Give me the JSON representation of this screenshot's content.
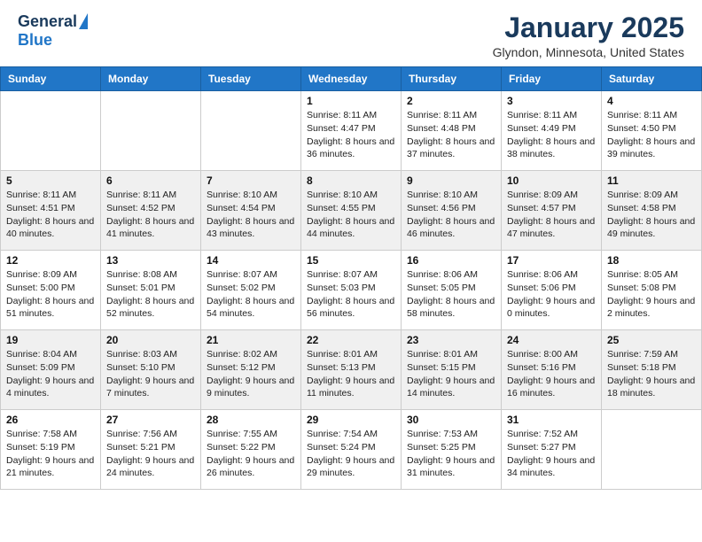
{
  "logo": {
    "general": "General",
    "blue": "Blue"
  },
  "title": "January 2025",
  "location": "Glyndon, Minnesota, United States",
  "days_header": [
    "Sunday",
    "Monday",
    "Tuesday",
    "Wednesday",
    "Thursday",
    "Friday",
    "Saturday"
  ],
  "weeks": [
    [
      {
        "day": "",
        "info": ""
      },
      {
        "day": "",
        "info": ""
      },
      {
        "day": "",
        "info": ""
      },
      {
        "day": "1",
        "info": "Sunrise: 8:11 AM\nSunset: 4:47 PM\nDaylight: 8 hours and 36 minutes."
      },
      {
        "day": "2",
        "info": "Sunrise: 8:11 AM\nSunset: 4:48 PM\nDaylight: 8 hours and 37 minutes."
      },
      {
        "day": "3",
        "info": "Sunrise: 8:11 AM\nSunset: 4:49 PM\nDaylight: 8 hours and 38 minutes."
      },
      {
        "day": "4",
        "info": "Sunrise: 8:11 AM\nSunset: 4:50 PM\nDaylight: 8 hours and 39 minutes."
      }
    ],
    [
      {
        "day": "5",
        "info": "Sunrise: 8:11 AM\nSunset: 4:51 PM\nDaylight: 8 hours and 40 minutes."
      },
      {
        "day": "6",
        "info": "Sunrise: 8:11 AM\nSunset: 4:52 PM\nDaylight: 8 hours and 41 minutes."
      },
      {
        "day": "7",
        "info": "Sunrise: 8:10 AM\nSunset: 4:54 PM\nDaylight: 8 hours and 43 minutes."
      },
      {
        "day": "8",
        "info": "Sunrise: 8:10 AM\nSunset: 4:55 PM\nDaylight: 8 hours and 44 minutes."
      },
      {
        "day": "9",
        "info": "Sunrise: 8:10 AM\nSunset: 4:56 PM\nDaylight: 8 hours and 46 minutes."
      },
      {
        "day": "10",
        "info": "Sunrise: 8:09 AM\nSunset: 4:57 PM\nDaylight: 8 hours and 47 minutes."
      },
      {
        "day": "11",
        "info": "Sunrise: 8:09 AM\nSunset: 4:58 PM\nDaylight: 8 hours and 49 minutes."
      }
    ],
    [
      {
        "day": "12",
        "info": "Sunrise: 8:09 AM\nSunset: 5:00 PM\nDaylight: 8 hours and 51 minutes."
      },
      {
        "day": "13",
        "info": "Sunrise: 8:08 AM\nSunset: 5:01 PM\nDaylight: 8 hours and 52 minutes."
      },
      {
        "day": "14",
        "info": "Sunrise: 8:07 AM\nSunset: 5:02 PM\nDaylight: 8 hours and 54 minutes."
      },
      {
        "day": "15",
        "info": "Sunrise: 8:07 AM\nSunset: 5:03 PM\nDaylight: 8 hours and 56 minutes."
      },
      {
        "day": "16",
        "info": "Sunrise: 8:06 AM\nSunset: 5:05 PM\nDaylight: 8 hours and 58 minutes."
      },
      {
        "day": "17",
        "info": "Sunrise: 8:06 AM\nSunset: 5:06 PM\nDaylight: 9 hours and 0 minutes."
      },
      {
        "day": "18",
        "info": "Sunrise: 8:05 AM\nSunset: 5:08 PM\nDaylight: 9 hours and 2 minutes."
      }
    ],
    [
      {
        "day": "19",
        "info": "Sunrise: 8:04 AM\nSunset: 5:09 PM\nDaylight: 9 hours and 4 minutes."
      },
      {
        "day": "20",
        "info": "Sunrise: 8:03 AM\nSunset: 5:10 PM\nDaylight: 9 hours and 7 minutes."
      },
      {
        "day": "21",
        "info": "Sunrise: 8:02 AM\nSunset: 5:12 PM\nDaylight: 9 hours and 9 minutes."
      },
      {
        "day": "22",
        "info": "Sunrise: 8:01 AM\nSunset: 5:13 PM\nDaylight: 9 hours and 11 minutes."
      },
      {
        "day": "23",
        "info": "Sunrise: 8:01 AM\nSunset: 5:15 PM\nDaylight: 9 hours and 14 minutes."
      },
      {
        "day": "24",
        "info": "Sunrise: 8:00 AM\nSunset: 5:16 PM\nDaylight: 9 hours and 16 minutes."
      },
      {
        "day": "25",
        "info": "Sunrise: 7:59 AM\nSunset: 5:18 PM\nDaylight: 9 hours and 18 minutes."
      }
    ],
    [
      {
        "day": "26",
        "info": "Sunrise: 7:58 AM\nSunset: 5:19 PM\nDaylight: 9 hours and 21 minutes."
      },
      {
        "day": "27",
        "info": "Sunrise: 7:56 AM\nSunset: 5:21 PM\nDaylight: 9 hours and 24 minutes."
      },
      {
        "day": "28",
        "info": "Sunrise: 7:55 AM\nSunset: 5:22 PM\nDaylight: 9 hours and 26 minutes."
      },
      {
        "day": "29",
        "info": "Sunrise: 7:54 AM\nSunset: 5:24 PM\nDaylight: 9 hours and 29 minutes."
      },
      {
        "day": "30",
        "info": "Sunrise: 7:53 AM\nSunset: 5:25 PM\nDaylight: 9 hours and 31 minutes."
      },
      {
        "day": "31",
        "info": "Sunrise: 7:52 AM\nSunset: 5:27 PM\nDaylight: 9 hours and 34 minutes."
      },
      {
        "day": "",
        "info": ""
      }
    ]
  ]
}
